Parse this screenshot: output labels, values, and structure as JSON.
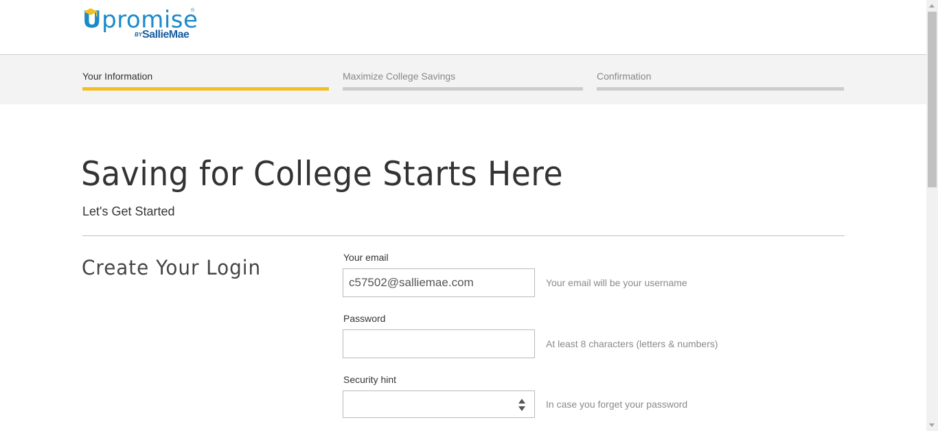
{
  "brand": {
    "logo_word": "promise",
    "logo_u": "U",
    "logo_by": "BY",
    "logo_partner": "SallieMae",
    "logo_tm": "®",
    "colors": {
      "primary": "#1a8ac9",
      "partner": "#1a5ea0",
      "cap": "#f5bf22"
    }
  },
  "progress": {
    "steps": [
      {
        "label": "Your Information",
        "state": "active"
      },
      {
        "label": "Maximize College Savings",
        "state": "inactive"
      },
      {
        "label": "Confirmation",
        "state": "inactive"
      }
    ],
    "colors": {
      "active": "#f5bf22",
      "inactive": "#cccccc"
    }
  },
  "main": {
    "title": "Saving for College Starts Here",
    "subtitle": "Let's Get Started",
    "section_title": "Create Your Login"
  },
  "form": {
    "email": {
      "label": "Your email",
      "value": "c57502@salliemae.com",
      "help": "Your email will be your username"
    },
    "password": {
      "label": "Password",
      "value": "",
      "help": "At least 8 characters (letters & numbers)"
    },
    "security_hint": {
      "label": "Security hint",
      "selected": "",
      "help": "In case you forget your password"
    }
  }
}
